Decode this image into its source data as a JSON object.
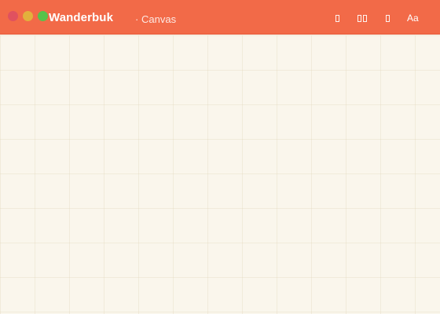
{
  "app": {
    "name": "Wanderbuk",
    "separator": "·",
    "document": "Canvas"
  },
  "window_controls": [
    "close",
    "minimize",
    "zoom"
  ],
  "toolbar": {
    "items": [
      {
        "icon": "note-icon"
      },
      {
        "icon": "layout-icon"
      },
      {
        "icon": "sticker-icon"
      },
      {
        "icon": "text-style-icon",
        "label": "Aa"
      }
    ]
  },
  "colors": {
    "accent": "#f26a48",
    "canvas": "#faf6ec",
    "close": "#e0515f",
    "minimize": "#e2b13c",
    "zoom": "#58c24a"
  }
}
